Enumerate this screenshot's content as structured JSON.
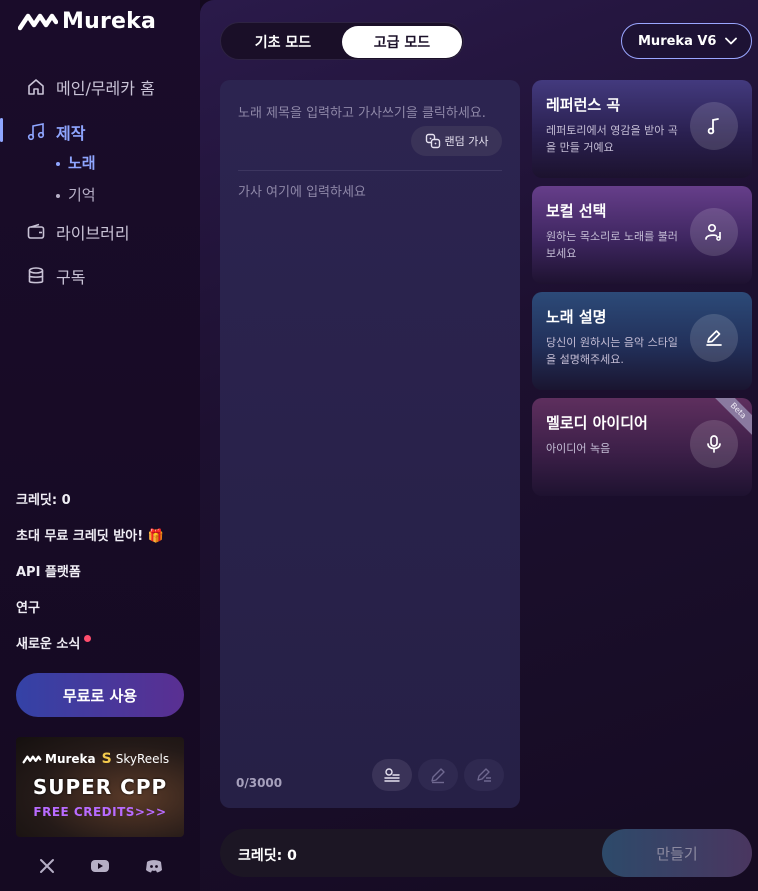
{
  "app": {
    "name": "Mureka"
  },
  "nav": {
    "home": "메인/무레카 홈",
    "create": "제작",
    "sub_song": "노래",
    "sub_memory": "기억",
    "library": "라이브러리",
    "subscribe": "구독"
  },
  "sidebar_links": {
    "credits": "크레딧: 0",
    "invite": "초대 무료 크레딧 받아!",
    "invite_emoji": "🎁",
    "api": "API 플랫폼",
    "research": "연구",
    "news": "새로운 소식"
  },
  "free_button": "무료로 사용",
  "banner": {
    "brand1": "Mureka",
    "brand2": "SkyReels",
    "headline": "SUPER CPP",
    "sub": "FREE CREDITS>>>"
  },
  "modes": {
    "basic": "기초 모드",
    "advanced": "고급 모드",
    "selected": "advanced"
  },
  "model": {
    "selected": "Mureka V6"
  },
  "editor": {
    "title_placeholder": "노래 제목을 입력하고 가사쓰기을 클릭하세요.",
    "random_lyrics": "랜덤 가사",
    "lyrics_placeholder": "가사 여기에 입력하세요",
    "counter": "0/3000"
  },
  "cards": [
    {
      "title": "레퍼런스 곡",
      "desc": "레퍼토리에서 영감을 받아 곡을 만들 거예요",
      "icon": "music-note-icon"
    },
    {
      "title": "보컬 선택",
      "desc": "원하는 목소리로 노래를 불러보세요",
      "icon": "voice-user-icon"
    },
    {
      "title": "노래 설명",
      "desc": "당신이 원하시는 음악 스타일을 설명해주세요.",
      "icon": "pen-icon"
    },
    {
      "title": "멜로디 아이디어",
      "desc": "아이디어 녹음",
      "icon": "microphone-icon",
      "badge": "Beta"
    }
  ],
  "bottom": {
    "credits": "크레딧: 0",
    "create_button": "만들기"
  },
  "colors": {
    "accent": "#8fa6ff",
    "background": "#14091f",
    "notification": "#ff4d6d"
  }
}
